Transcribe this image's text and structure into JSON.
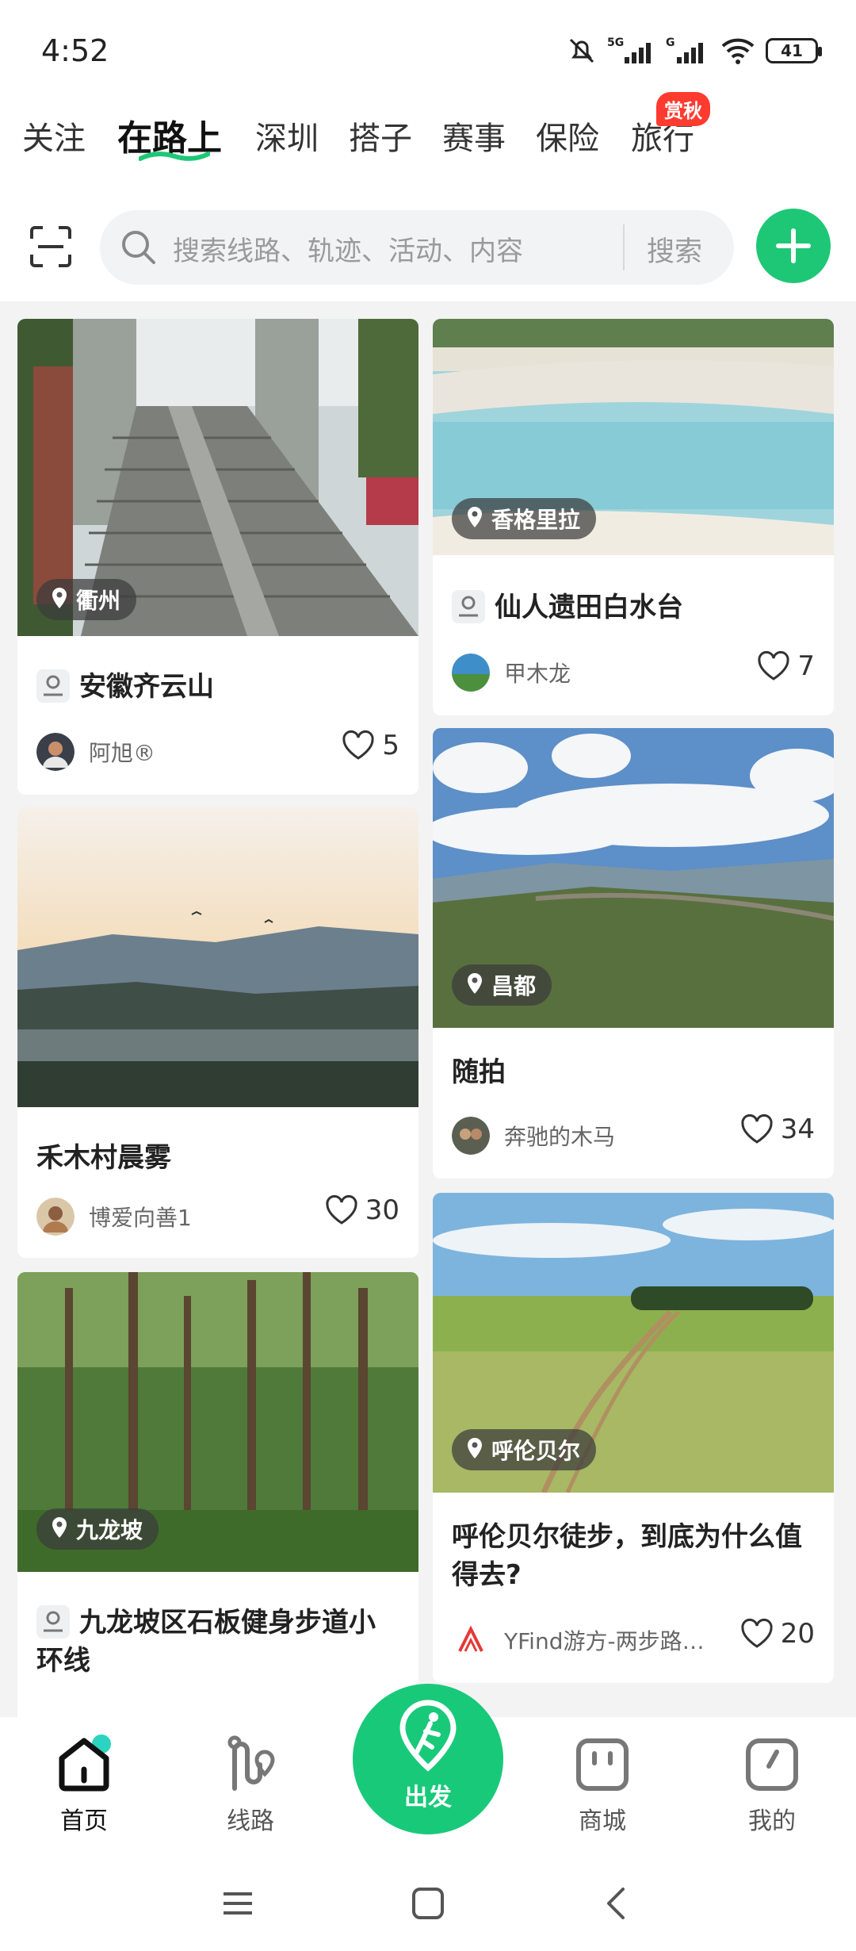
{
  "status": {
    "time": "4:52",
    "battery": "41"
  },
  "tabs": [
    {
      "label": "关注"
    },
    {
      "label": "在路上"
    },
    {
      "label": "深圳"
    },
    {
      "label": "搭子"
    },
    {
      "label": "赛事"
    },
    {
      "label": "保险"
    },
    {
      "label": "旅行"
    }
  ],
  "tab_badge": "赏秋",
  "search": {
    "placeholder": "搜索线路、轨迹、活动、内容",
    "button": "搜索"
  },
  "feed": {
    "left": [
      {
        "location": "衢州",
        "title": "安徽齐云山",
        "author": "阿旭®",
        "likes": "5"
      },
      {
        "title": "禾木村晨雾",
        "author": "博爱向善1",
        "likes": "30"
      },
      {
        "location": "九龙坡",
        "title": "九龙坡区石板健身步道小环线"
      }
    ],
    "right": [
      {
        "location": "香格里拉",
        "title": "仙人遗田白水台",
        "author": "甲木龙",
        "likes": "7"
      },
      {
        "location": "昌都",
        "title": "随拍",
        "author": "奔驰的木马",
        "likes": "34"
      },
      {
        "location": "呼伦贝尔",
        "title": "呼伦贝尔徒步，到底为什么值得去?",
        "author": "YFind游方-两步路官方",
        "likes": "20"
      }
    ]
  },
  "nav": {
    "home": "首页",
    "routes": "线路",
    "go": "出发",
    "shop": "商城",
    "me": "我的"
  },
  "colors": {
    "brand": "#19c97a",
    "badge": "#ff3b30"
  }
}
